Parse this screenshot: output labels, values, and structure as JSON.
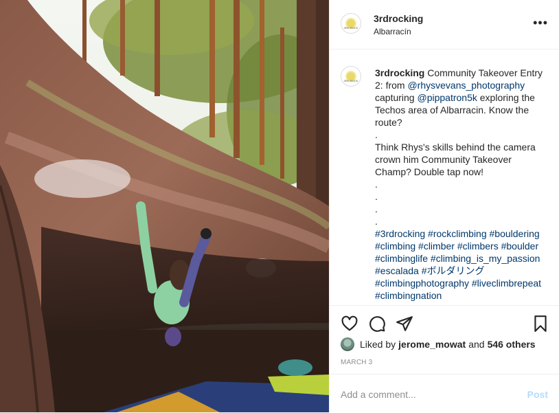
{
  "post": {
    "username": "3rdrocking",
    "location": "Albarracín",
    "more_icon": "•••",
    "avatar_text": "3RD ROCK"
  },
  "caption": {
    "username": "3rdrocking",
    "text_1": " Community Takeover Entry 2: from ",
    "mention_1": "@rhysvevans_photography",
    "text_2": " capturing ",
    "mention_2": "@pippatron5k",
    "text_3": " exploring the Techos area of Albarracin. Know the route?",
    "dot": ".",
    "paragraph_2": "Think Rhys's skills behind the camera crown him Community Takeover Champ? Double tap now!",
    "hashtags": "#3rdrocking #rockclimbing #bouldering #climbing #climber #climbers #boulder #climbinglife #climbing_is_my_passion #escalada #ボルダリング #climbingphotography #liveclimbrepeat #climbingnation"
  },
  "likes": {
    "prefix": "Liked by",
    "user": "jerome_mowat",
    "and": "and",
    "others": "546 others"
  },
  "date": "MARCH 3",
  "comment_box": {
    "placeholder": "Add a comment...",
    "post_label": "Post"
  },
  "colors": {
    "link": "#00376b",
    "muted": "#8e8e8e",
    "post_disabled": "#b3dbff"
  }
}
